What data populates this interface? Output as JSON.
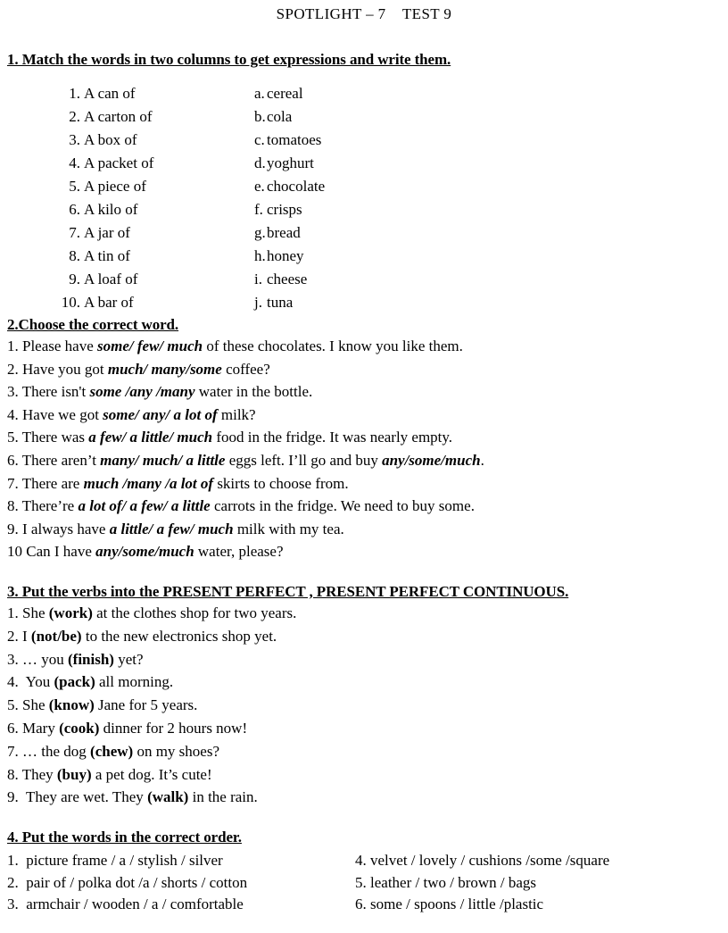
{
  "document": {
    "title": "SPOTLIGHT – 7    TEST 9"
  },
  "exercise1": {
    "heading": "1. Match the words in two columns to get expressions and write them.",
    "left_items": [
      {
        "num": "1.",
        "text": "A can of"
      },
      {
        "num": "2.",
        "text": "A carton of"
      },
      {
        "num": "3.",
        "text": "A box of"
      },
      {
        "num": "4.",
        "text": "A packet of"
      },
      {
        "num": "5.",
        "text": "A piece of"
      },
      {
        "num": "6.",
        "text": "A kilo of"
      },
      {
        "num": "7.",
        "text": "A jar of"
      },
      {
        "num": "8.",
        "text": "A tin of"
      },
      {
        "num": "9.",
        "text": "A loaf of"
      },
      {
        "num": "10.",
        "text": "A bar of"
      }
    ],
    "right_items": [
      {
        "letter": "a.",
        "text": "cereal"
      },
      {
        "letter": "b.",
        "text": "cola"
      },
      {
        "letter": "c.",
        "text": "tomatoes"
      },
      {
        "letter": "d.",
        "text": "yoghurt"
      },
      {
        "letter": "e.",
        "text": "chocolate"
      },
      {
        "letter": "f.",
        "text": "crisps"
      },
      {
        "letter": "g.",
        "text": "bread"
      },
      {
        "letter": "h.",
        "text": "honey"
      },
      {
        "letter": "i.",
        "text": "cheese"
      },
      {
        "letter": "j.",
        "text": "tuna"
      }
    ]
  },
  "exercise2": {
    "heading": "2.Choose the correct word.",
    "items": [
      {
        "num": "1. ",
        "pre": "Please have ",
        "choice": "some/ few/ much",
        "post": " of these chocolates. I know you like them."
      },
      {
        "num": "2. ",
        "pre": "Have you got ",
        "choice": "much/ many/some",
        "post": " coffee?"
      },
      {
        "num": "3. ",
        "pre": "There isn't ",
        "choice": "some /any /many",
        "post": " water in the bottle."
      },
      {
        "num": "4. ",
        "pre": "Have we got ",
        "choice": "some/ any/ a lot of",
        "post": " milk?"
      },
      {
        "num": "5. ",
        "pre": "There was ",
        "choice": "a few/ a little/ much",
        "post": " food in the fridge. It was nearly empty."
      },
      {
        "num": "6. ",
        "pre": "There aren’t ",
        "choice": "many/ much/ a little",
        "post": " eggs left. I’ll go and buy ",
        "choice2": "any/some/much",
        "post2": "."
      },
      {
        "num": "7. ",
        "pre": "There are ",
        "choice": "much /many /a lot of",
        "post": " skirts to choose from."
      },
      {
        "num": "8. ",
        "pre": "There’re ",
        "choice": "a lot of/ a few/ a little",
        "post": " carrots in the fridge. We need to buy some."
      },
      {
        "num": "9. ",
        "pre": "I always have ",
        "choice": "a little/ a few/ much",
        "post": " milk with my tea."
      },
      {
        "num": "10 ",
        "pre": "Can I have ",
        "choice": "any/some/much",
        "post": " water, please?"
      }
    ]
  },
  "exercise3": {
    "heading": "3. Put the verbs into the PRESENT PERFECT , PRESENT PERFECT CONTINUOUS.",
    "items": [
      {
        "num": "1. ",
        "pre": "She ",
        "verb": "(work)",
        "post": " at the clothes shop for two years."
      },
      {
        "num": "2. ",
        "pre": "I ",
        "verb": "(not/be)",
        "post": " to the new electronics shop yet."
      },
      {
        "num": "3. ",
        "pre": "… you ",
        "verb": "(finish)",
        "post": " yet?"
      },
      {
        "num": "4.  ",
        "pre": "You ",
        "verb": "(pack)",
        "post": " all morning."
      },
      {
        "num": "5. ",
        "pre": "She ",
        "verb": "(know)",
        "post": " Jane for 5 years."
      },
      {
        "num": "6. ",
        "pre": "Mary ",
        "verb": "(cook)",
        "post": " dinner for 2 hours now!"
      },
      {
        "num": "7. ",
        "pre": "… the dog ",
        "verb": "(chew)",
        "post": " on my shoes?"
      },
      {
        "num": "8. ",
        "pre": "They ",
        "verb": "(buy)",
        "post": " a pet dog. It’s cute!"
      },
      {
        "num": "9.  ",
        "pre": "They are wet. They ",
        "verb": "(walk)",
        "post": " in the rain."
      }
    ]
  },
  "exercise4": {
    "heading": "4. Put the words in the correct order.",
    "left_items": [
      {
        "num": "1.  ",
        "text": "picture frame / a / stylish / silver"
      },
      {
        "num": "2.  ",
        "text": "pair of / polka dot /a / shorts / cotton"
      },
      {
        "num": "3.  ",
        "text": "armchair / wooden / a / comfortable"
      }
    ],
    "right_items": [
      {
        "num": "4. ",
        "text": "velvet / lovely / cushions /some /square"
      },
      {
        "num": "5. ",
        "text": "leather / two / brown / bags"
      },
      {
        "num": "6. ",
        "text": "some / spoons / little /plastic"
      }
    ]
  }
}
